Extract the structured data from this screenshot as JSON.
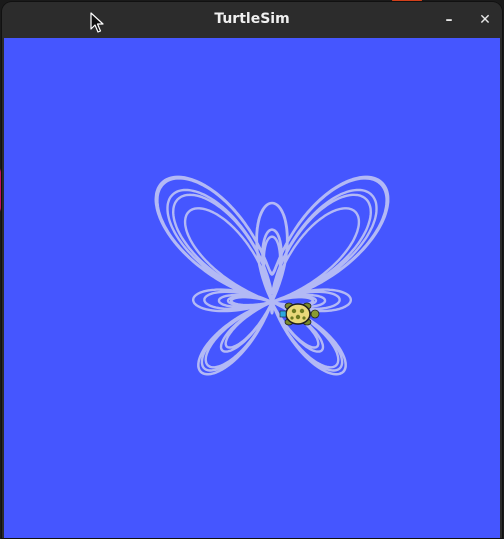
{
  "window": {
    "title": "TurtleSim",
    "minimize_glyph": "–",
    "close_glyph": "✕"
  },
  "canvas": {
    "background_color": "#4556ff",
    "pen_color": "#b3b9f5"
  },
  "icons": {
    "minimize": "minimize-icon",
    "close": "close-icon",
    "cursor": "mouse-pointer-icon",
    "turtle": "turtle-icon"
  }
}
